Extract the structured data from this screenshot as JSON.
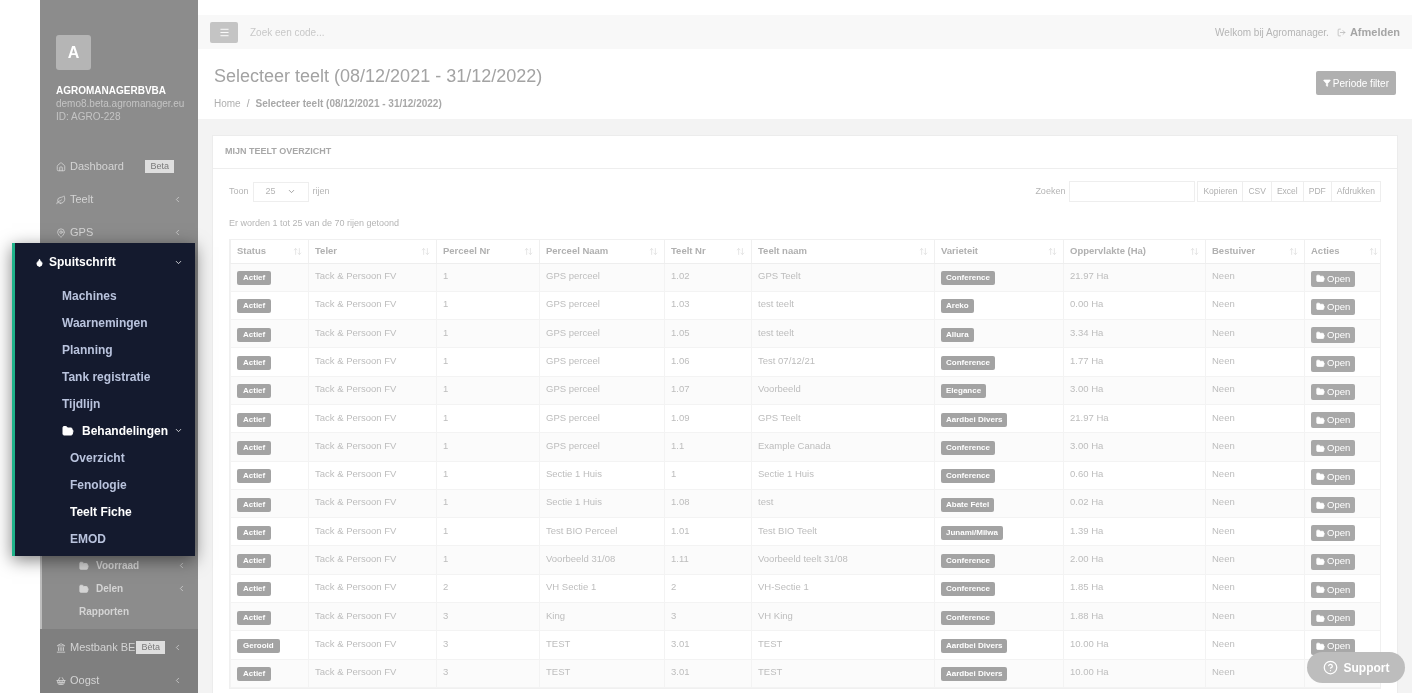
{
  "sidebar": {
    "avatar": "A",
    "company": "AGROMANAGERBVBA",
    "domain": "demo8.beta.agromanager.eu",
    "id": "ID: AGRO-228",
    "menu_top": [
      {
        "label": "Dashboard",
        "kind": "link",
        "badge": "Beta"
      },
      {
        "label": "Teelt",
        "kind": "group"
      },
      {
        "label": "GPS",
        "kind": "group"
      }
    ],
    "sub_items": [
      {
        "label": "Voorraad",
        "kind": "folder"
      },
      {
        "label": "Delen",
        "kind": "folder"
      },
      {
        "label": "Rapporten",
        "kind": "link"
      }
    ],
    "menu_bottom": [
      {
        "label": "Mestbank BE",
        "kind": "group",
        "badge": "Bèta"
      },
      {
        "label": "Oogst",
        "kind": "group"
      }
    ]
  },
  "popup_menu": {
    "title": "Spuitschrift",
    "expanded": true,
    "items": [
      {
        "label": "Machines",
        "selected": false
      },
      {
        "label": "Waarnemingen",
        "selected": false
      },
      {
        "label": "Planning",
        "selected": false
      },
      {
        "label": "Tank registratie",
        "selected": false
      },
      {
        "label": "Tijdlijn",
        "selected": false
      },
      {
        "label": "Behandelingen",
        "selected": false,
        "expanded": true,
        "children": [
          {
            "label": "Overzicht",
            "selected": false
          },
          {
            "label": "Fenologie",
            "selected": false
          },
          {
            "label": "Teelt Fiche",
            "selected": true
          },
          {
            "label": "EMOD",
            "selected": false
          }
        ]
      }
    ]
  },
  "top_bar": {
    "search_placeholder": "Zoek een code...",
    "welcome": "Welkom bij Agromanager.",
    "logout": "Afmelden"
  },
  "page": {
    "title": "Selecteer teelt (08/12/2021 - 31/12/2022)",
    "breadcrumb": [
      "Home",
      "Selecteer teelt (08/12/2021 - 31/12/2022)"
    ],
    "breadcrumb_separator": "/",
    "filter_button": "Periode filter"
  },
  "card": {
    "title": "MIJN TEELT OVERZICHT",
    "show_label": "Toon",
    "page_size": "25",
    "rows_label": "rijen",
    "search_label": "Zoeken",
    "export_buttons": [
      "Kopieren",
      "CSV",
      "Excel",
      "PDF",
      "Afdrukken"
    ],
    "info": "Er worden 1 tot 25 van de 70 rijen getoond"
  },
  "table": {
    "columns": [
      "Status",
      "Teler",
      "Perceel Nr",
      "Perceel Naam",
      "Teelt Nr",
      "Teelt naam",
      "Varieteit",
      "Oppervlakte (Ha)",
      "Bestuiver",
      "Acties"
    ],
    "rows": [
      [
        "Actief",
        "Tack & Persoon FV",
        "1",
        "GPS perceel",
        "1.02",
        "GPS Teelt",
        "Conference",
        "21.97 Ha",
        "Neen",
        "Open"
      ],
      [
        "Actief",
        "Tack & Persoon FV",
        "1",
        "GPS perceel",
        "1.03",
        "test teelt",
        "Areko",
        "0.00 Ha",
        "Neen",
        "Open"
      ],
      [
        "Actief",
        "Tack & Persoon FV",
        "1",
        "GPS perceel",
        "1.05",
        "test teelt",
        "Allura",
        "3.34 Ha",
        "Neen",
        "Open"
      ],
      [
        "Actief",
        "Tack & Persoon FV",
        "1",
        "GPS perceel",
        "1.06",
        "Test 07/12/21",
        "Conference",
        "1.77 Ha",
        "Neen",
        "Open"
      ],
      [
        "Actief",
        "Tack & Persoon FV",
        "1",
        "GPS perceel",
        "1.07",
        "Voorbeeld",
        "Elegance",
        "3.00 Ha",
        "Neen",
        "Open"
      ],
      [
        "Actief",
        "Tack & Persoon FV",
        "1",
        "GPS perceel",
        "1.09",
        "GPS Teelt",
        "Aardbei Divers",
        "21.97 Ha",
        "Neen",
        "Open"
      ],
      [
        "Actief",
        "Tack & Persoon FV",
        "1",
        "GPS perceel",
        "1.1",
        "Example Canada",
        "Conference",
        "3.00 Ha",
        "Neen",
        "Open"
      ],
      [
        "Actief",
        "Tack & Persoon FV",
        "1",
        "Sectie 1 Huis",
        "1",
        "Sectie 1 Huis",
        "Conference",
        "0.60 Ha",
        "Neen",
        "Open"
      ],
      [
        "Actief",
        "Tack & Persoon FV",
        "1",
        "Sectie 1 Huis",
        "1.08",
        "test",
        "Abate Fétel",
        "0.02 Ha",
        "Neen",
        "Open"
      ],
      [
        "Actief",
        "Tack & Persoon FV",
        "1",
        "Test BIO Perceel",
        "1.01",
        "Test BIO Teelt",
        "Junami/Milwa",
        "1.39 Ha",
        "Neen",
        "Open"
      ],
      [
        "Actief",
        "Tack & Persoon FV",
        "1",
        "Voorbeeld 31/08",
        "1.11",
        "Voorbeeld teelt 31/08",
        "Conference",
        "2.00 Ha",
        "Neen",
        "Open"
      ],
      [
        "Actief",
        "Tack & Persoon FV",
        "2",
        "VH Sectie 1",
        "2",
        "VH-Sectie 1",
        "Conference",
        "1.85 Ha",
        "Neen",
        "Open"
      ],
      [
        "Actief",
        "Tack & Persoon FV",
        "3",
        "King",
        "3",
        "VH King",
        "Conference",
        "1.88 Ha",
        "Neen",
        "Open"
      ],
      [
        "Gerooid",
        "Tack & Persoon FV",
        "3",
        "TEST",
        "3.01",
        "TEST",
        "Aardbei Divers",
        "10.00 Ha",
        "Neen",
        "Open"
      ],
      [
        "Actief",
        "Tack & Persoon FV",
        "3",
        "TEST",
        "3.01",
        "TEST",
        "Aardbei Divers",
        "10.00 Ha",
        "Neen"
      ]
    ]
  },
  "support_button": "Support"
}
